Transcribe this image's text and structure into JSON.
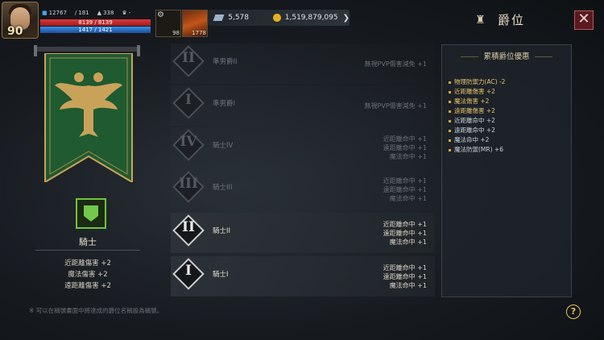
{
  "hud": {
    "level": "90",
    "stat1": "12767",
    "stat2": "181",
    "stat3": "338",
    "stat4": "-",
    "hp_text": "8139 / 8139",
    "mp_text": "1417 / 1421",
    "hp_fraction": 1.0,
    "mp_fraction": 0.997,
    "slot1_count": "98",
    "slot2_count": "1778",
    "gems": "5,578",
    "gold": "1,519,879,095",
    "title": "爵位",
    "close": "✕"
  },
  "left": {
    "rank_name": "騎士",
    "bonuses": [
      "近距離傷害 +2",
      "魔法傷害 +2",
      "遠距離傷害 +2"
    ]
  },
  "ranks": [
    {
      "numeral": "II",
      "name": "準男爵II",
      "effects": [
        "無視PVP傷害減免 +1"
      ],
      "active": false
    },
    {
      "numeral": "I",
      "name": "準男爵I",
      "effects": [
        "無視PVP傷害減免 +1"
      ],
      "active": false
    },
    {
      "numeral": "IV",
      "name": "騎士IV",
      "effects": [
        "近距離命中 +1",
        "遠距離命中 +1",
        "魔法命中 +1"
      ],
      "active": false
    },
    {
      "numeral": "III",
      "name": "騎士III",
      "effects": [
        "近距離命中 +1",
        "遠距離命中 +1",
        "魔法命中 +1"
      ],
      "active": false
    },
    {
      "numeral": "II",
      "name": "騎士II",
      "effects": [
        "近距離命中 +1",
        "遠距離命中 +1",
        "魔法命中 +1"
      ],
      "active": true
    },
    {
      "numeral": "I",
      "name": "騎士I",
      "effects": [
        "近距離命中 +1",
        "遠距離命中 +1",
        "魔法命中 +1"
      ],
      "active": true
    }
  ],
  "cumulative": {
    "title": "累積爵位優惠",
    "items": [
      {
        "text": "物理防禦力(AC) -2",
        "color": "gold"
      },
      {
        "text": "近距離傷害 +2",
        "color": "gold"
      },
      {
        "text": "魔法傷害 +2",
        "color": "gold"
      },
      {
        "text": "遠距離傷害 +2",
        "color": "gold"
      },
      {
        "text": "近距離命中 +2",
        "color": "pale"
      },
      {
        "text": "遠距離命中 +2",
        "color": "pale"
      },
      {
        "text": "魔法命中 +2",
        "color": "pale"
      },
      {
        "text": "魔法防禦(MR) +6",
        "color": "pale"
      }
    ]
  },
  "footer": "※ 可以在稱號畫面中將達成的爵位名稱設為稱號。",
  "help": "?"
}
